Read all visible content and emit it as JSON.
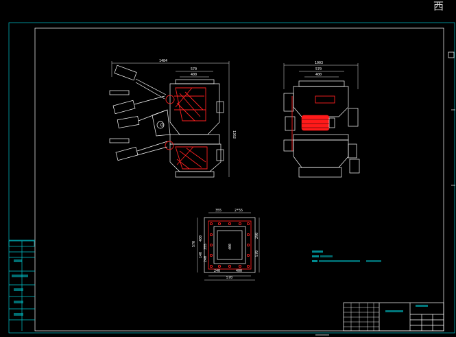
{
  "corner_glyph": "西",
  "front_view": {
    "dim_overall_width": "1484",
    "dim_top_width": "570",
    "dim_inner_width": "400",
    "dim_height": "1362"
  },
  "side_view": {
    "dim_overall_width": "1003",
    "dim_top_width": "570",
    "dim_inner_width": "400"
  },
  "flange_view": {
    "dim_top_left": "355",
    "dim_top_right": "2*55",
    "dim_left": "570",
    "dim_left_b": "400",
    "dim_left_c": "355",
    "dim_left_d": "140",
    "dim_left_e": "240",
    "dim_center": "400",
    "dim_right_a": "290",
    "dim_right_b": "570",
    "dim_bottom_a": "240",
    "dim_bottom_b": "400",
    "dim_bottom_c": "570"
  },
  "colors": {
    "background": "#000000",
    "line": "#ffffff",
    "frame": "#00c8d0",
    "highlight": "#ff2020"
  }
}
